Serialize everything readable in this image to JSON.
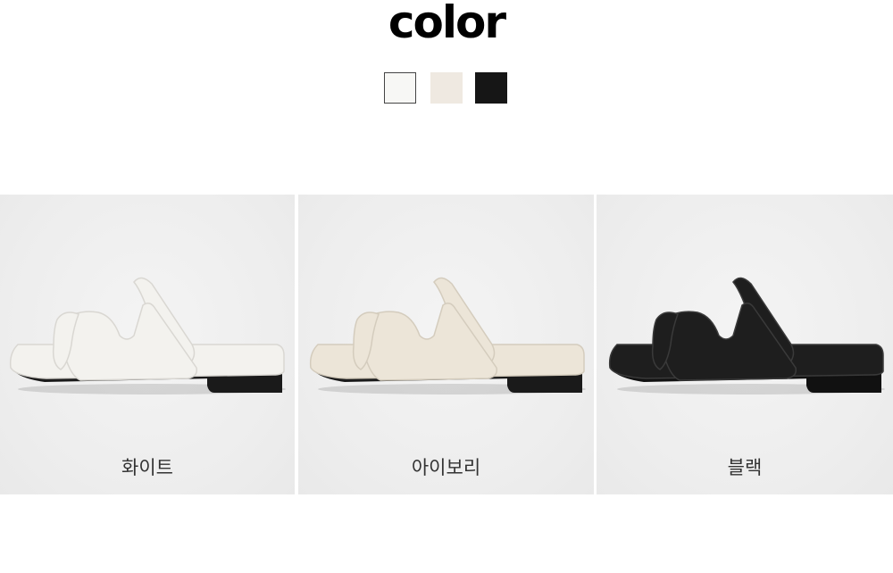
{
  "header": {
    "title": "color"
  },
  "swatches": [
    {
      "name": "white-swatch",
      "color": "#f7f7f5",
      "border": "#444444"
    },
    {
      "name": "ivory-swatch",
      "color": "#efe9e1",
      "border": "#efe9e1"
    },
    {
      "name": "black-swatch",
      "color": "#161616",
      "border": "#161616"
    }
  ],
  "products": [
    {
      "label": "화이트",
      "upper": "#f3f2ee",
      "edge": "#d9d7d2",
      "sole": "#1a1a1a"
    },
    {
      "label": "아이보리",
      "upper": "#ece5d8",
      "edge": "#d4ccbd",
      "sole": "#1a1a1a"
    },
    {
      "label": "블랙",
      "upper": "#1e1e1e",
      "edge": "#3a3a3a",
      "sole": "#111111"
    }
  ]
}
